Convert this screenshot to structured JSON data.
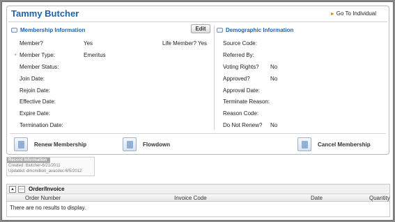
{
  "header": {
    "title": "Tammy Butcher",
    "goto": "Go To Individual"
  },
  "edit_label": "Edit",
  "membership": {
    "heading": "Membership Information",
    "fields": [
      {
        "label": "Member?",
        "value": "Yes"
      },
      {
        "label": "Member Type:",
        "value": "Emeritus",
        "required": true
      },
      {
        "label": "Member Status:",
        "value": ""
      },
      {
        "label": "Join Date:",
        "value": ""
      },
      {
        "label": "Rejoin Date:",
        "value": ""
      },
      {
        "label": "Effective Date:",
        "value": ""
      },
      {
        "label": "Expire Date:",
        "value": ""
      },
      {
        "label": "Termination Date:",
        "value": ""
      }
    ],
    "life_member": "Life Member? Yes"
  },
  "demographic": {
    "heading": "Demographic Information",
    "fields": [
      {
        "label": "Source Code:",
        "value": ""
      },
      {
        "label": "Referred By:",
        "value": ""
      },
      {
        "label": "Voting Rights?",
        "value": "No"
      },
      {
        "label": "Approved?",
        "value": "No"
      },
      {
        "label": "Approval Date:",
        "value": ""
      },
      {
        "label": "Terminate Reason:",
        "value": ""
      },
      {
        "label": "Reason Code:",
        "value": ""
      },
      {
        "label": "Do Not Renew?",
        "value": "No"
      }
    ]
  },
  "actions": {
    "renew": "Renew Membership",
    "flowdown": "Flowdown",
    "cancel": "Cancel Membership"
  },
  "record": {
    "title": "Record Information",
    "created": "Created: tbutcher-6/21/2011",
    "updated": "Updated: dmcmillion_avacdoc-6/5/2012"
  },
  "order": {
    "title": "Order/Invoice",
    "columns": [
      "Order Number",
      "Invoice Code",
      "Date",
      "Quantity"
    ],
    "empty": "There are no results to display."
  }
}
